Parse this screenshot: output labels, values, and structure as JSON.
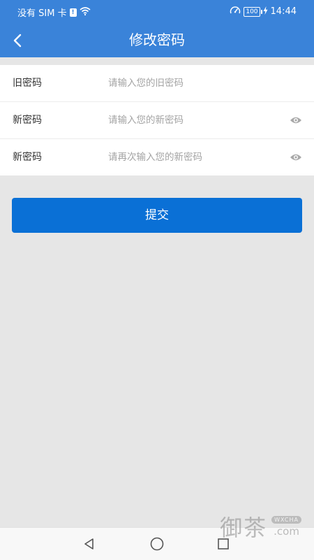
{
  "status_bar": {
    "carrier": "没有 SIM 卡",
    "sim_alert": "!",
    "battery": "100",
    "time": "14:44"
  },
  "header": {
    "title": "修改密码"
  },
  "form": {
    "old_password": {
      "label": "旧密码",
      "placeholder": "请输入您的旧密码"
    },
    "new_password": {
      "label": "新密码",
      "placeholder": "请输入您的新密码"
    },
    "confirm_password": {
      "label": "新密码",
      "placeholder": "请再次输入您的新密码"
    }
  },
  "submit_label": "提交",
  "watermark": {
    "chars": "御茶",
    "badge": "WXCHA",
    "domain": ".com"
  },
  "colors": {
    "header_bg": "#3a83d9",
    "button_bg": "#0a70d6",
    "page_bg": "#e6e6e6",
    "placeholder": "#a3a3a3"
  },
  "icons": {
    "back": "chevron-left-icon",
    "eye": "eye-icon",
    "wifi": "wifi-icon",
    "speed": "speedometer-icon",
    "charging": "bolt-icon",
    "nav_back": "triangle-back-icon",
    "nav_home": "circle-home-icon",
    "nav_recent": "square-recent-icon"
  }
}
